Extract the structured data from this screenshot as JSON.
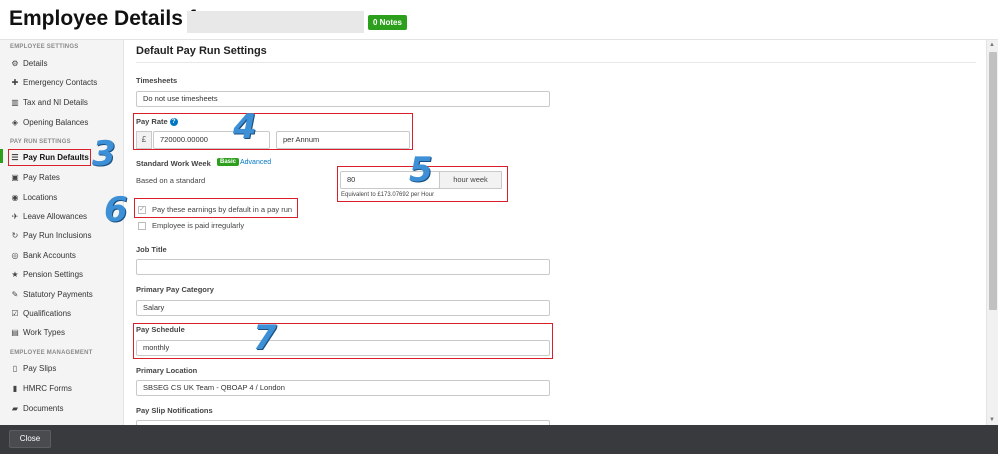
{
  "header": {
    "title": "Employee Details for",
    "notes_badge": "0 Notes"
  },
  "sidebar": {
    "sections": {
      "employee_settings": "EMPLOYEE SETTINGS",
      "pay_run_settings": "PAY RUN SETTINGS",
      "employee_management": "EMPLOYEE MANAGEMENT"
    },
    "items": {
      "details": "Details",
      "emergency_contacts": "Emergency Contacts",
      "tax_ni": "Tax and NI Details",
      "opening_balances": "Opening Balances",
      "pay_run_defaults": "Pay Run Defaults",
      "pay_rates": "Pay Rates",
      "locations": "Locations",
      "leave_allowances": "Leave Allowances",
      "pay_run_inclusions": "Pay Run Inclusions",
      "bank_accounts": "Bank Accounts",
      "pension_settings": "Pension Settings",
      "statutory_payments": "Statutory Payments",
      "qualifications": "Qualifications",
      "work_types": "Work Types",
      "pay_slips": "Pay Slips",
      "hmrc_forms": "HMRC Forms",
      "documents": "Documents"
    },
    "active_item": "pay_run_defaults"
  },
  "main": {
    "section_title": "Default Pay Run Settings",
    "timesheets": {
      "label": "Timesheets",
      "value": "Do not use timesheets"
    },
    "pay_rate": {
      "label": "Pay Rate",
      "currency": "£",
      "amount": "720000.00000",
      "period": "per Annum"
    },
    "standard_work_week": {
      "label": "Standard Work Week",
      "basic_badge": "Basic",
      "advanced_link": "Advanced",
      "based_on": "Based on a standard",
      "hours": "80",
      "unit": "hour week",
      "equivalent": "Equivalent to £173.07692 per Hour"
    },
    "checkboxes": {
      "default_earnings": {
        "label": "Pay these earnings by default in a pay run",
        "checked": true
      },
      "irregular": {
        "label": "Employee is paid irregularly",
        "checked": false
      }
    },
    "job_title": {
      "label": "Job Title",
      "value": ""
    },
    "primary_pay_category": {
      "label": "Primary Pay Category",
      "value": "Salary"
    },
    "pay_schedule": {
      "label": "Pay Schedule",
      "value": "monthly"
    },
    "primary_location": {
      "label": "Primary Location",
      "value": "SBSEG CS UK Team - QBOAP 4 / London"
    },
    "pay_slip_notifications": {
      "label": "Pay Slip Notifications"
    }
  },
  "annotations": [
    "3",
    "4",
    "5",
    "6",
    "7"
  ],
  "footer": {
    "close_label": "Close"
  },
  "colors": {
    "accent_green": "#2ca01c",
    "link_blue": "#0077c5",
    "annotation_red": "#d9202a",
    "annotation_number": "#3d8fd6",
    "footer_bg": "#393a3d"
  }
}
